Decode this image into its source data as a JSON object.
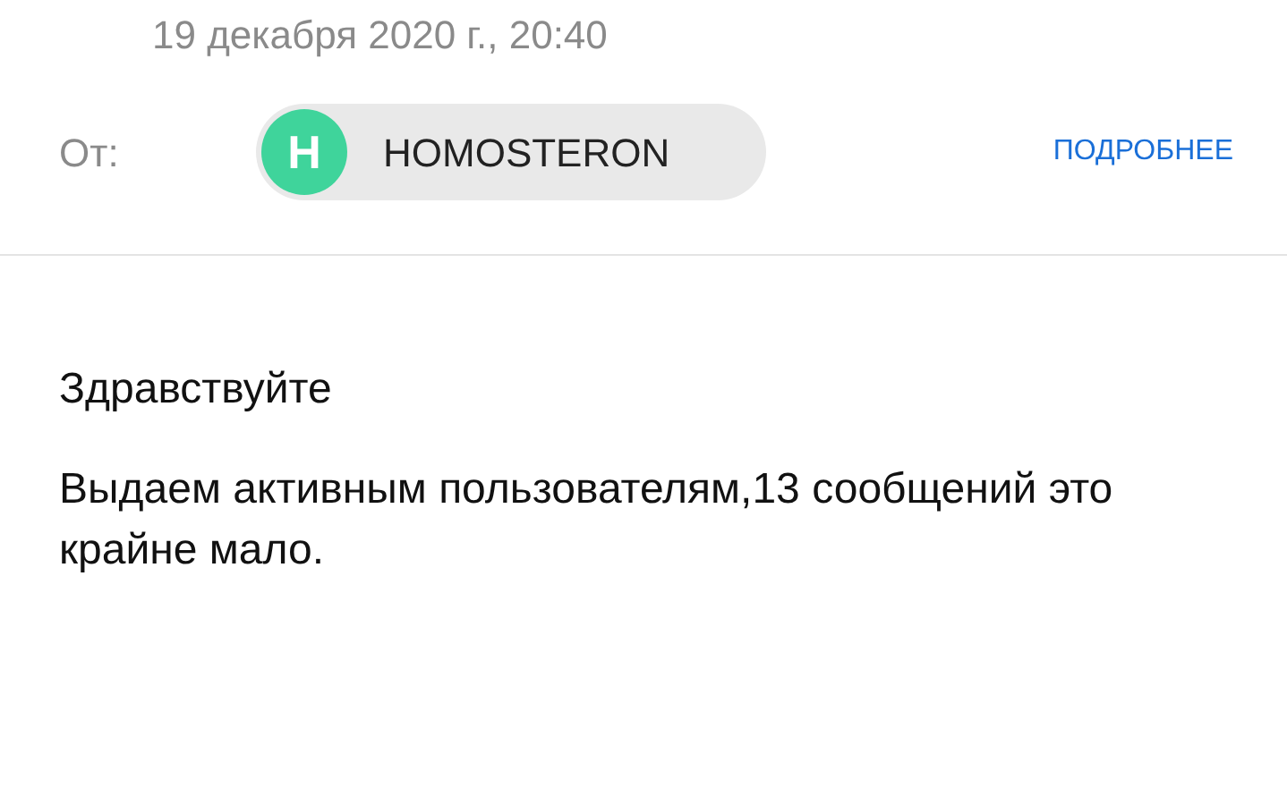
{
  "date": "19 декабря 2020 г., 20:40",
  "from_label": "От:",
  "sender": {
    "initial": "H",
    "name": "HOMOSTERON",
    "color": "#3fd49b"
  },
  "details_link": "ПОДРОБНЕЕ",
  "body": [
    "Здравствуйте",
    "Выдаем активным пользователям,13 сообщений это крайне мало."
  ]
}
